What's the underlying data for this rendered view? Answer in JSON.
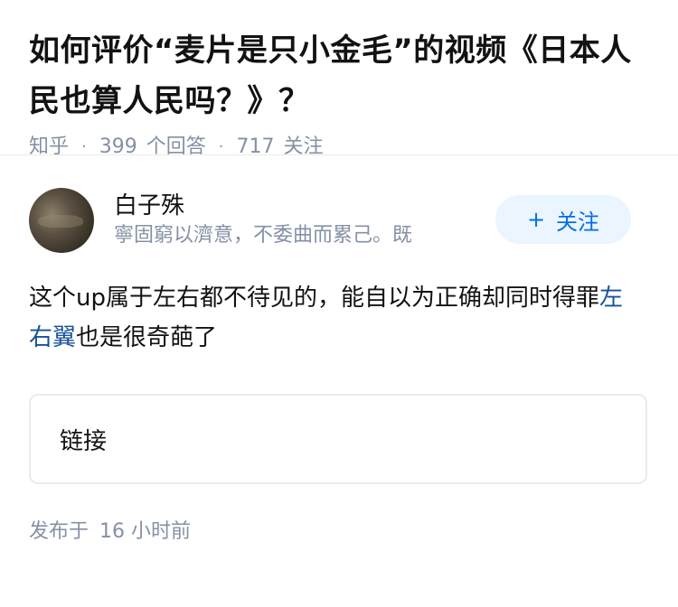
{
  "question": {
    "title": "如何评价“麦片是只小金毛”的视频《日本人民也算人民吗？》？",
    "source": "知乎",
    "answers_count": "399",
    "answers_label": "个回答",
    "followers_count": "717",
    "followers_label": "关注"
  },
  "answer": {
    "author_name": "白子殊",
    "author_bio": "寧固窮以濟意，不委曲而累己。既",
    "follow_label": "关注",
    "follow_plus": "+",
    "content_part1": "这个up属于左右都不待见的，能自以为正确却同时得罪",
    "content_link": "左右翼",
    "content_part2": "也是很奇葩了",
    "link_card_label": "链接",
    "time_prefix": "发布于",
    "time_value": "16 小时前"
  },
  "colors": {
    "accent": "#056de8",
    "muted": "#8590a6",
    "link": "#175199"
  }
}
